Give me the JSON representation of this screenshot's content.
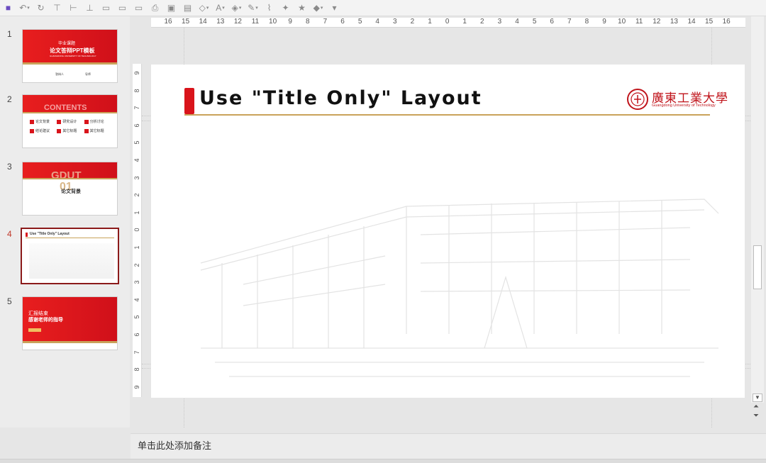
{
  "toolbar": {
    "icons": [
      "save-icon",
      "undo-icon",
      "redo-icon",
      "align-top-icon",
      "align-middle-icon",
      "align-bottom-icon",
      "align-left-icon",
      "align-center-icon",
      "align-right-icon",
      "print-icon",
      "picture-icon",
      "image-icon",
      "shape-icon",
      "font-color-icon",
      "fill-icon",
      "outline-icon",
      "format-painter-icon",
      "magic-icon",
      "star-icon",
      "eraser-icon",
      "more-icon"
    ]
  },
  "slides": [
    {
      "number": "1",
      "title_cn": "毕业课题",
      "subtitle_cn": "论文答辩PPT模板",
      "tag": "GUANGDONG UNIVERSITY OF TECHNOLOGY",
      "label_a": "答辩人",
      "label_b": "导师"
    },
    {
      "number": "2",
      "heading": "CONTENTS",
      "items": [
        "论文背景",
        "研究设计",
        "分析讨论",
        "结论建议",
        "其它标题",
        "其它标题"
      ]
    },
    {
      "number": "3",
      "heading": "GDUT",
      "big": "01",
      "label": "论文背景"
    },
    {
      "number": "4",
      "title": "Use \"Title Only\" Layout"
    },
    {
      "number": "5",
      "line1": "汇报结束",
      "line2": "感谢老师的指导"
    }
  ],
  "ruler": {
    "h_labels": [
      "16",
      "15",
      "14",
      "13",
      "12",
      "11",
      "10",
      "9",
      "8",
      "7",
      "6",
      "5",
      "4",
      "3",
      "2",
      "1",
      "0",
      "1",
      "2",
      "3",
      "4",
      "5",
      "6",
      "7",
      "8",
      "9",
      "10",
      "11",
      "12",
      "13",
      "14",
      "15",
      "16"
    ],
    "v_labels": [
      "9",
      "8",
      "7",
      "6",
      "5",
      "4",
      "3",
      "2",
      "1",
      "0",
      "1",
      "2",
      "3",
      "4",
      "5",
      "6",
      "7",
      "8",
      "9"
    ]
  },
  "slide": {
    "title": "Use \"Title Only\" Layout",
    "logo_cn": "廣東工業大學",
    "logo_en": "Guangdong University of Technology"
  },
  "notes": {
    "placeholder": "单击此处添加备注"
  },
  "colors": {
    "accent": "#d9141b",
    "gold": "#c9a25a",
    "active_border": "#8b1a1a"
  }
}
